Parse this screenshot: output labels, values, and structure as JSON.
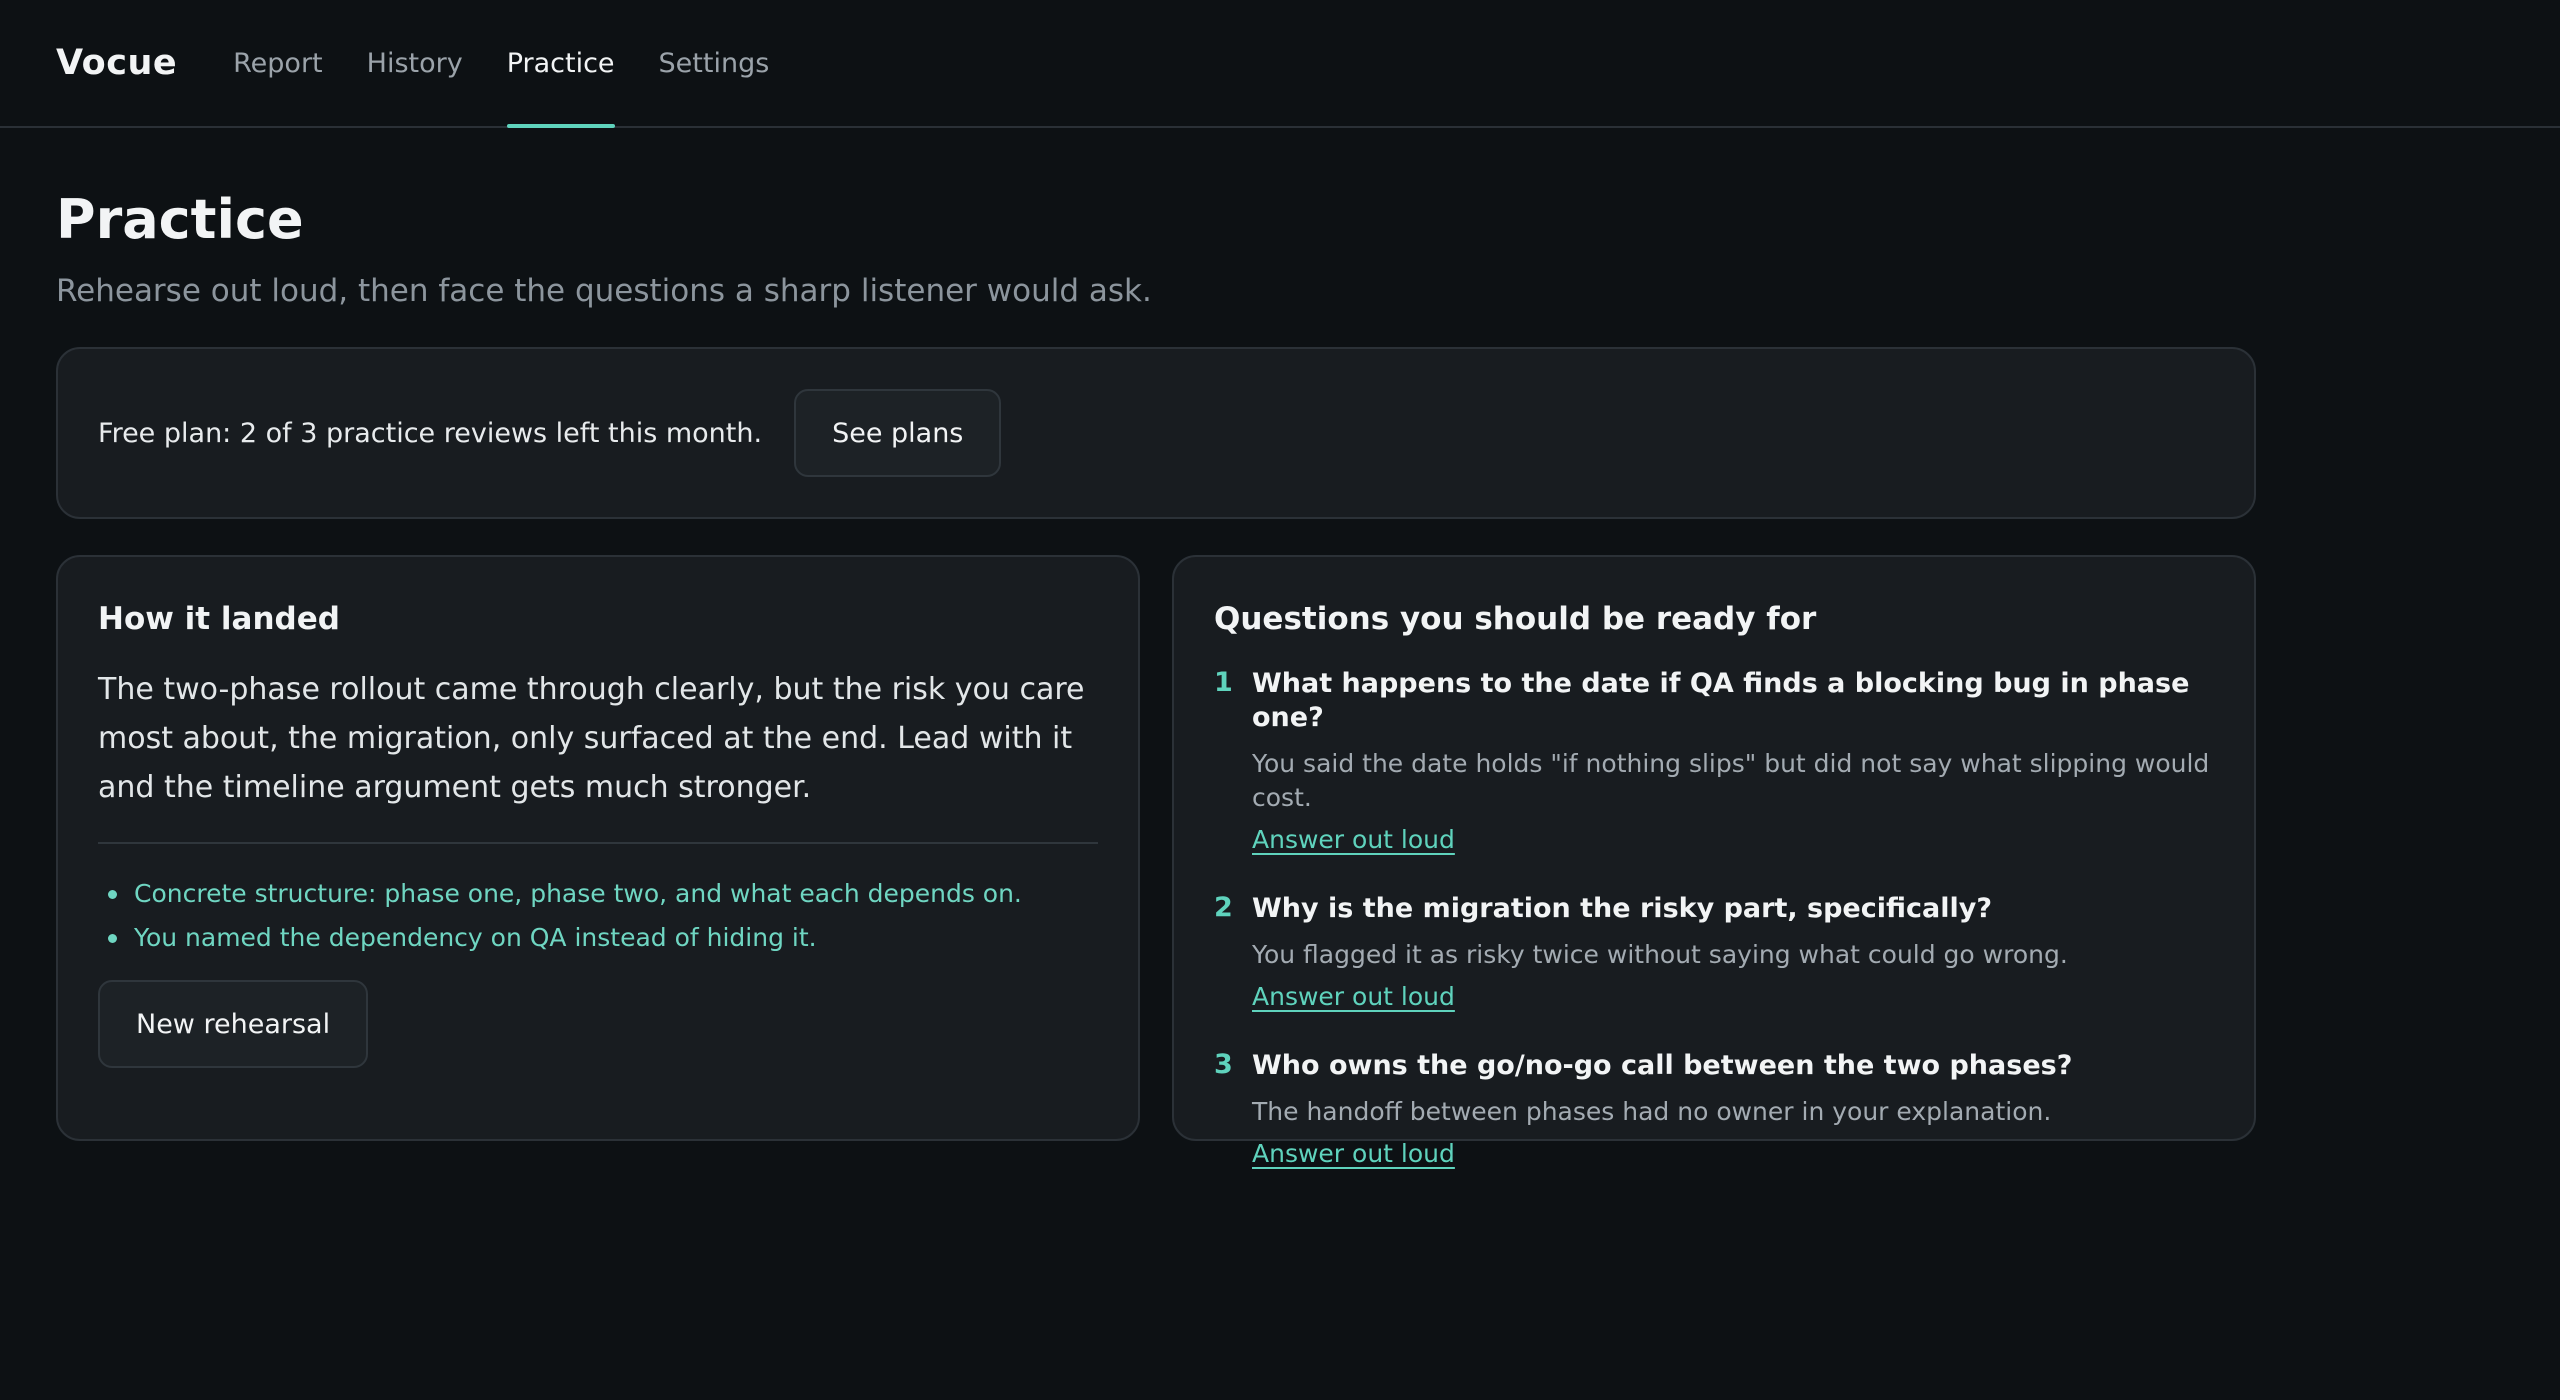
{
  "brand": "Vocue",
  "nav": [
    {
      "label": "Report",
      "active": false
    },
    {
      "label": "History",
      "active": false
    },
    {
      "label": "Practice",
      "active": true
    },
    {
      "label": "Settings",
      "active": false
    }
  ],
  "page": {
    "title": "Practice",
    "subtitle": "Rehearse out loud, then face the questions a sharp listener would ask."
  },
  "plan": {
    "text": "Free plan: 2 of 3 practice reviews left this month.",
    "button_label": "See plans"
  },
  "landed": {
    "title": "How it landed",
    "body": "The two-phase rollout came through clearly, but the risk you care most about, the migration, only surfaced at the end. Lead with it and the timeline argument gets much stronger.",
    "strengths": [
      "Concrete structure: phase one, phase two, and what each depends on.",
      "You named the dependency on QA instead of hiding it."
    ],
    "button_label": "New rehearsal"
  },
  "questions": {
    "title": "Questions you should be ready for",
    "items": [
      {
        "num": "1",
        "question": "What happens to the date if QA finds a blocking bug in phase one?",
        "note": "You said the date holds \"if nothing slips\" but did not say what slipping would cost.",
        "link": "Answer out loud"
      },
      {
        "num": "2",
        "question": "Why is the migration the risky part, specifically?",
        "note": "You flagged it as risky twice without saying what could go wrong.",
        "link": "Answer out loud"
      },
      {
        "num": "3",
        "question": "Who owns the go/no-go call between the two phases?",
        "note": "The handoff between phases had no owner in your explanation.",
        "link": "Answer out loud"
      }
    ]
  },
  "colors": {
    "accent": "#5fd3bd",
    "background": "#0d1114",
    "card": "#181c20"
  }
}
